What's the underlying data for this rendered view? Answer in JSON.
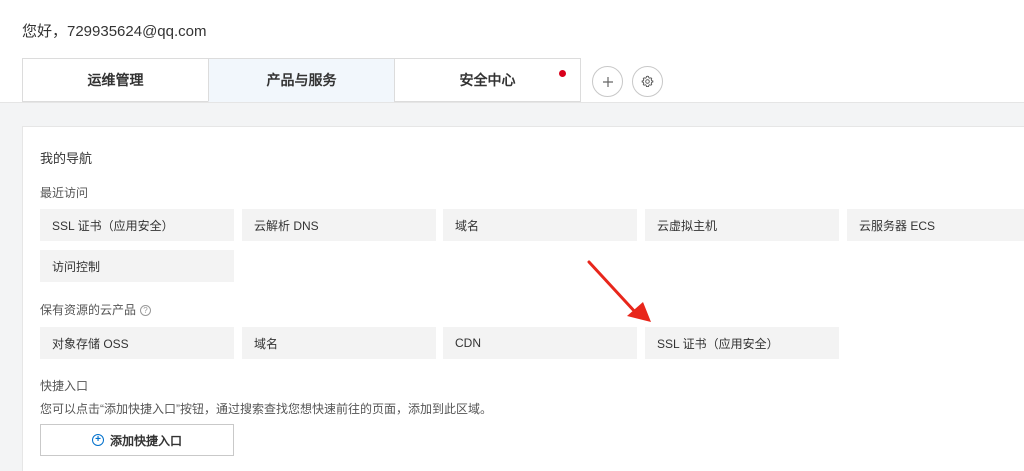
{
  "header": {
    "greeting": "您好，729935624@qq.com"
  },
  "tabs": [
    {
      "label": "运维管理"
    },
    {
      "label": "产品与服务"
    },
    {
      "label": "安全中心"
    }
  ],
  "tab_actions": {
    "add_icon": "plus-icon",
    "settings_icon": "gear-icon"
  },
  "nav": {
    "title": "我的导航",
    "recent": {
      "title": "最近访问",
      "items": [
        "SSL 证书（应用安全）",
        "云解析 DNS",
        "域名",
        "云虚拟主机",
        "云服务器 ECS",
        "访问控制"
      ]
    },
    "owned": {
      "title": "保有资源的云产品",
      "items": [
        "对象存储 OSS",
        "域名",
        "CDN",
        "SSL 证书（应用安全）"
      ]
    },
    "shortcut": {
      "title": "快捷入口",
      "desc": "您可以点击“添加快捷入口”按钮，通过搜索查找您想快速前往的页面，添加到此区域。",
      "add_label": "添加快捷入口"
    }
  },
  "colors": {
    "accent": "#0070cc",
    "notification_dot": "#d9001b",
    "annotation_arrow": "#e8261b"
  }
}
